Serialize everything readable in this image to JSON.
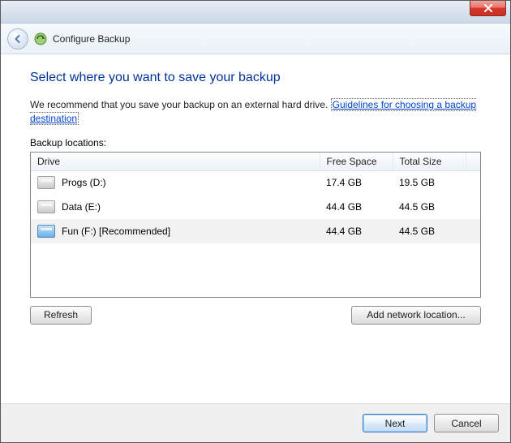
{
  "window": {
    "title": "Configure Backup"
  },
  "main": {
    "heading": "Select where you want to save your backup",
    "recommend_pre": "We recommend that you save your backup on an external hard drive. ",
    "guidelines_link": "Guidelines for choosing a backup destination",
    "list_label": "Backup locations:"
  },
  "table": {
    "columns": {
      "drive": "Drive",
      "free": "Free Space",
      "total": "Total Size"
    },
    "rows": [
      {
        "name": "Progs (D:)",
        "free": "17.4 GB",
        "total": "19.5 GB",
        "icon": "gray",
        "selected": false
      },
      {
        "name": "Data (E:)",
        "free": "44.4 GB",
        "total": "44.5 GB",
        "icon": "gray",
        "selected": false
      },
      {
        "name": "Fun (F:) [Recommended]",
        "free": "44.4 GB",
        "total": "44.5 GB",
        "icon": "blue",
        "selected": true
      }
    ]
  },
  "buttons": {
    "refresh": "Refresh",
    "add_network": "Add network location...",
    "next": "Next",
    "cancel": "Cancel"
  }
}
